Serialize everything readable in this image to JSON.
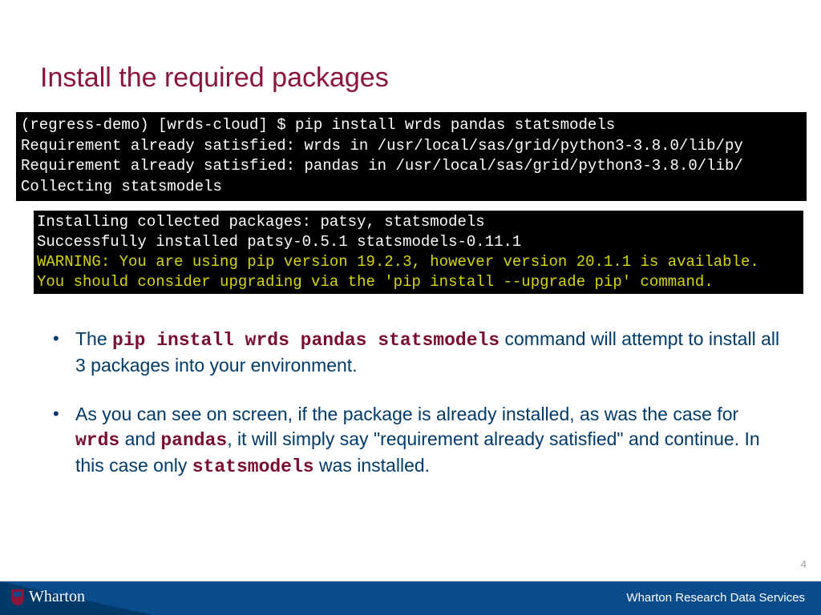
{
  "title": "Install the required packages",
  "terminal1": {
    "line1": "(regress-demo) [wrds-cloud] $ pip install wrds pandas statsmodels",
    "line2": "Requirement already satisfied: wrds in /usr/local/sas/grid/python3-3.8.0/lib/py",
    "line3": "Requirement already satisfied: pandas in /usr/local/sas/grid/python3-3.8.0/lib/",
    "line4": "Collecting statsmodels"
  },
  "terminal2": {
    "line1": "Installing collected packages: patsy, statsmodels",
    "line2": "Successfully installed patsy-0.5.1 statsmodels-0.11.1",
    "warn1": "WARNING: You are using pip version 19.2.3, however version 20.1.1 is available.",
    "warn2": "You should consider upgrading via the 'pip install --upgrade pip' command."
  },
  "bullets": {
    "b1_pre": "The ",
    "b1_code": "pip install wrds pandas statsmodels",
    "b1_post": " command will attempt to install all 3 packages into your environment.",
    "b2_pre": "As you can see on screen, if the package is already installed, as was the case for ",
    "b2_code1": "wrds",
    "b2_mid1": " and ",
    "b2_code2": "pandas",
    "b2_mid2": ", it will simply say \"requirement already satisfied\" and continue.  In this case only ",
    "b2_code3": "statsmodels",
    "b2_post": " was installed."
  },
  "page_number": "4",
  "footer": {
    "brand": "Wharton",
    "service": "Wharton Research Data Services"
  }
}
